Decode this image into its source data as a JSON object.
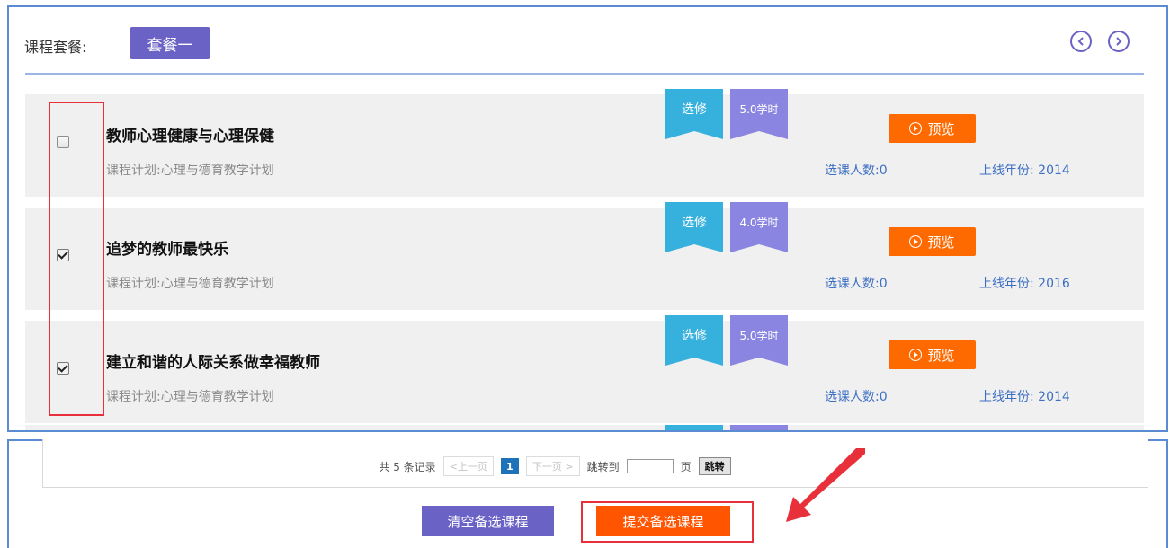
{
  "header": {
    "package_label": "课程套餐:",
    "package_tab": "套餐一",
    "prev_icon": "chevron-left-circle-icon",
    "next_icon": "chevron-right-circle-icon"
  },
  "courses": [
    {
      "title": "教师心理健康与心理保健",
      "plan": "课程计划:心理与德育教学计划",
      "type_tag": "选修",
      "hours_tag": "5.0学时",
      "preview": "预览",
      "enroll": "选课人数:0",
      "year": "上线年份: 2014",
      "checked": false
    },
    {
      "title": "追梦的教师最快乐",
      "plan": "课程计划:心理与德育教学计划",
      "type_tag": "选修",
      "hours_tag": "4.0学时",
      "preview": "预览",
      "enroll": "选课人数:0",
      "year": "上线年份: 2016",
      "checked": true
    },
    {
      "title": "建立和谐的人际关系做幸福教师",
      "plan": "课程计划:心理与德育教学计划",
      "type_tag": "选修",
      "hours_tag": "5.0学时",
      "preview": "预览",
      "enroll": "选课人数:0",
      "year": "上线年份: 2014",
      "checked": true
    }
  ],
  "pagination": {
    "total": "共 5 条记录",
    "prev": "<上一页",
    "current": "1",
    "next": "下一页 >",
    "jump_label": "跳转到",
    "jump_value": "",
    "page_unit": "页",
    "jump_button": "跳转"
  },
  "actions": {
    "clear": "清空备选课程",
    "submit": "提交备选课程"
  },
  "colors": {
    "purple": "#6b62c6",
    "orange": "#ff5500",
    "ribbon_blue": "#36b0dc",
    "ribbon_purple": "#8a85e0",
    "annotation_red": "#e8303a",
    "panel_border": "#5b8bd2"
  }
}
